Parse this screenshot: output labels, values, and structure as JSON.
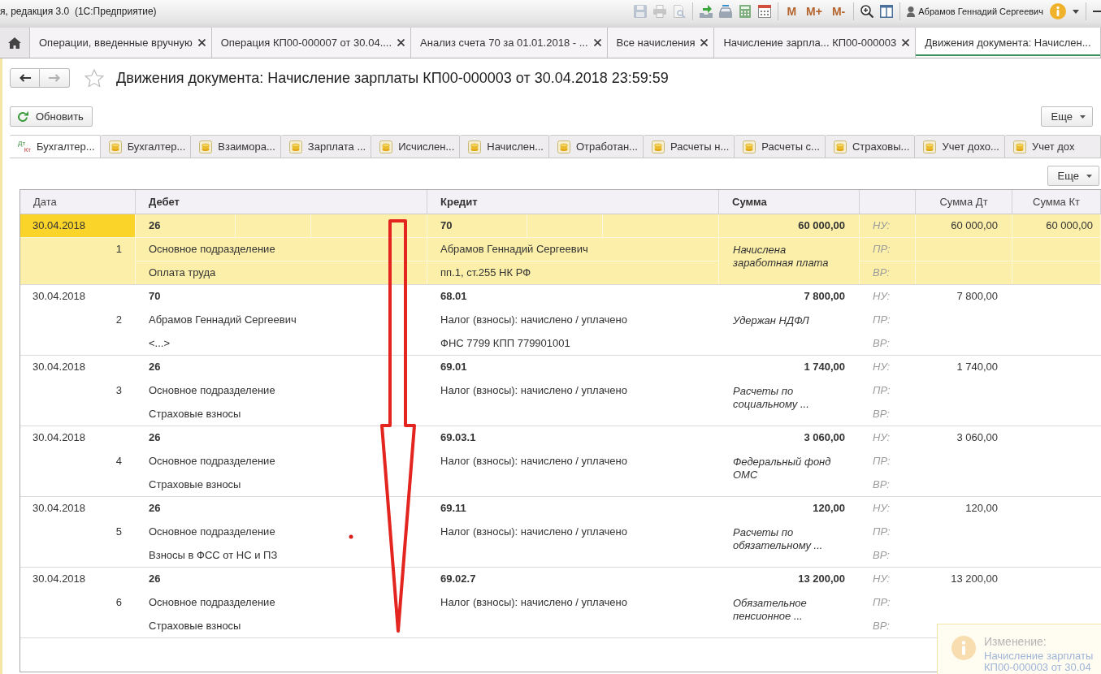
{
  "window": {
    "title": "я, редакция 3.0  (1С:Предприятие)",
    "toolbar": [
      {
        "kind": "save",
        "disabled": true
      },
      {
        "kind": "print",
        "disabled": true
      },
      {
        "kind": "preview",
        "disabled": true
      },
      {
        "kind": "separator"
      },
      {
        "kind": "upload",
        "disabled": false
      },
      {
        "kind": "scanner",
        "disabled": false
      },
      {
        "kind": "calculator",
        "disabled": false
      },
      {
        "kind": "calendar",
        "disabled": false
      },
      {
        "kind": "separator"
      },
      {
        "kind": "memory",
        "label": "M",
        "disabled": false
      },
      {
        "kind": "memory",
        "label": "M+",
        "disabled": false
      },
      {
        "kind": "memory",
        "label": "M-",
        "disabled": false
      },
      {
        "kind": "separator"
      },
      {
        "kind": "zoom",
        "disabled": false
      },
      {
        "kind": "panel",
        "disabled": false
      },
      {
        "kind": "separator"
      }
    ],
    "user": "Абрамов Геннадий Сергеевич"
  },
  "open_tabs": [
    {
      "label": "Операции, введенные вручную",
      "selected": false,
      "closable": true
    },
    {
      "label": "Операция КП00-000007 от 30.04....",
      "selected": false,
      "closable": true
    },
    {
      "label": "Анализ счета 70 за 01.01.2018 - ...",
      "selected": false,
      "closable": true
    },
    {
      "label": "Все начисления",
      "selected": false,
      "closable": true
    },
    {
      "label": "Начисление зарпла... КП00-000003",
      "selected": false,
      "closable": true
    },
    {
      "label": "Движения документа: Начислен...",
      "selected": true,
      "closable": false
    }
  ],
  "form": {
    "back": {
      "disabled": false
    },
    "forward": {
      "disabled": true
    },
    "favorite": false,
    "title": "Движения документа: Начисление зарплаты КП00-000003 от 30.04.2018 23:59:59",
    "refresh_button": "Обновить",
    "more_button": "Еще"
  },
  "register_tabs": [
    {
      "kind": "accounting",
      "icon_labels": [
        "Дт",
        "Кт"
      ],
      "label": "Бухгалтер...",
      "selected": true
    },
    {
      "kind": "register",
      "label": "Бухгалтер...",
      "selected": false
    },
    {
      "kind": "register",
      "label": "Взаимора...",
      "selected": false
    },
    {
      "kind": "register",
      "label": "Зарплата ...",
      "selected": false
    },
    {
      "kind": "register",
      "label": "Исчислен...",
      "selected": false
    },
    {
      "kind": "register",
      "label": "Начислен...",
      "selected": false
    },
    {
      "kind": "register",
      "label": "Отработан...",
      "selected": false
    },
    {
      "kind": "register",
      "label": "Расчеты н...",
      "selected": false
    },
    {
      "kind": "register",
      "label": "Расчеты с...",
      "selected": false
    },
    {
      "kind": "register",
      "label": "Страховы...",
      "selected": false
    },
    {
      "kind": "register",
      "label": "Учет дохо...",
      "selected": false
    },
    {
      "kind": "register",
      "label": "Учет дох",
      "selected": false
    }
  ],
  "table": {
    "more_button": "Еще",
    "columns": [
      {
        "label": "Дата",
        "bold": false
      },
      {
        "label": "Дебет",
        "bold": true
      },
      {
        "label": "Кредит",
        "bold": true
      },
      {
        "label": "Сумма",
        "bold": true
      },
      {
        "label": "Сумма Дт",
        "bold": false
      },
      {
        "label": "Сумма Кт",
        "bold": false
      }
    ],
    "rows": [
      {
        "date": "30.04.2018",
        "number": "1",
        "debit": [
          "26",
          "Основное подразделение",
          "Оплата труда"
        ],
        "credit": [
          "70",
          "Абрамов Геннадий Сергеевич",
          "пп.1, ст.255 НК РФ"
        ],
        "amount": "60 000,00",
        "content": "Начислена заработная плата",
        "ledgers": [
          "НУ:",
          "ПР:",
          "ВР:"
        ],
        "amount_dt": "60 000,00",
        "amount_kt": "60 000,00",
        "selected": true
      },
      {
        "date": "30.04.2018",
        "number": "2",
        "debit": [
          "70",
          "Абрамов Геннадий Сергеевич",
          "<...>"
        ],
        "credit": [
          "68.01",
          "Налог (взносы): начислено / уплачено",
          "ФНС 7799 КПП 779901001"
        ],
        "amount": "7 800,00",
        "content": "Удержан НДФЛ",
        "ledgers": [
          "НУ:",
          "ПР:",
          "ВР:"
        ],
        "amount_dt": "7 800,00",
        "selected": false
      },
      {
        "date": "30.04.2018",
        "number": "3",
        "debit": [
          "26",
          "Основное подразделение",
          "Страховые взносы"
        ],
        "credit": [
          "69.01",
          "Налог (взносы): начислено / уплачено"
        ],
        "amount": "1 740,00",
        "content": "Расчеты по социальному ...",
        "ledgers": [
          "НУ:",
          "ПР:",
          "ВР:"
        ],
        "amount_dt": "1 740,00",
        "selected": false
      },
      {
        "date": "30.04.2018",
        "number": "4",
        "debit": [
          "26",
          "Основное подразделение",
          "Страховые взносы"
        ],
        "credit": [
          "69.03.1",
          "Налог (взносы): начислено / уплачено"
        ],
        "amount": "3 060,00",
        "content": "Федеральный фонд ОМС",
        "ledgers": [
          "НУ:",
          "ПР:",
          "ВР:"
        ],
        "amount_dt": "3 060,00",
        "selected": false
      },
      {
        "date": "30.04.2018",
        "number": "5",
        "debit": [
          "26",
          "Основное подразделение",
          "Взносы в ФСС от НС и ПЗ"
        ],
        "credit": [
          "69.11",
          "Налог (взносы): начислено / уплачено"
        ],
        "amount": "120,00",
        "content": "Расчеты по обязательному ...",
        "ledgers": [
          "НУ:",
          "ПР:",
          "ВР:"
        ],
        "amount_dt": "120,00",
        "selected": false
      },
      {
        "date": "30.04.2018",
        "number": "6",
        "debit": [
          "26",
          "Основное подразделение",
          "Страховые взносы"
        ],
        "credit": [
          "69.02.7",
          "Налог (взносы): начислено / уплачено"
        ],
        "amount": "13 200,00",
        "content": "Обязательное пенсионное ...",
        "ledgers": [
          "НУ:",
          "ПР:",
          "ВР:"
        ],
        "amount_dt": "13 200,00",
        "selected": false
      }
    ]
  },
  "notification": {
    "title": "Изменение:",
    "link": "Начисление зарплаты КП00-000003 от 30.04"
  },
  "annotations": {
    "arrow": true,
    "dot": true
  }
}
